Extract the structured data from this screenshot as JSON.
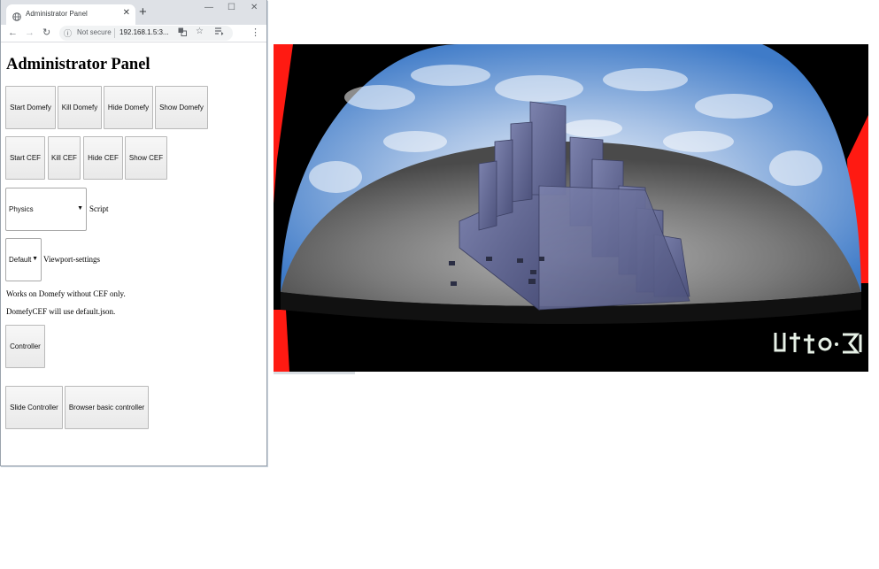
{
  "browser": {
    "tab_title": "Administrator Panel",
    "new_tab_symbol": "+",
    "tab_close_symbol": "✕",
    "window_controls": {
      "minimize": "—",
      "maximize": "☐",
      "close": "✕"
    },
    "nav": {
      "back": "←",
      "forward": "→",
      "reload": "↻",
      "menu": "⋮"
    },
    "address": {
      "security_text": "Not secure",
      "url": "192.168.1.5:3..."
    },
    "icons": [
      "globe-icon",
      "info-icon",
      "translate-icon",
      "star-icon",
      "reading-list-icon"
    ]
  },
  "panel": {
    "title": "Administrator Panel",
    "domefy_buttons": [
      "Start Domefy",
      "Kill Domefy",
      "Hide Domefy",
      "Show Domefy"
    ],
    "cef_buttons": [
      "Start CEF",
      "Kill CEF",
      "Hide CEF",
      "Show CEF"
    ],
    "script_select": {
      "value": "Physics",
      "label": "Script"
    },
    "viewport_select": {
      "value": "Default",
      "label": "Viewport-settings"
    },
    "note_1": "Works on Domefy without CEF only.",
    "note_2": "DomefyCEF will use default.json.",
    "controller_button": "Controller",
    "slide_controller_button": "Slide Controller",
    "browser_controller_button": "Browser basic controller"
  },
  "viewport": {
    "logo_text": "Urho3D",
    "colors": {
      "frame_red": "#ff1a12",
      "sky_blue": "#3f7bc8",
      "ground": "#6e6e6e",
      "blocks": "#5d6391"
    }
  }
}
